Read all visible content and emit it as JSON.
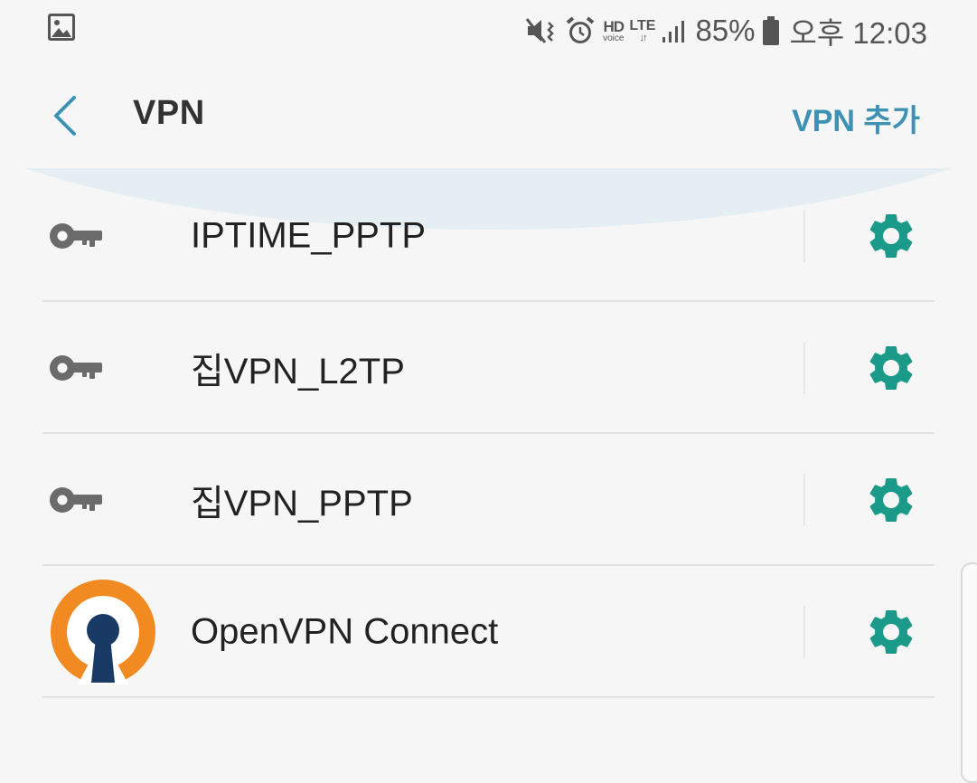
{
  "status_bar": {
    "battery": "85%",
    "time": "오후 12:03",
    "hd_label": "HD",
    "hd_sub": "voice",
    "network_label": "LTE"
  },
  "header": {
    "title": "VPN",
    "add_button_label": "VPN 추가"
  },
  "vpn_list": [
    {
      "name": "IPTIME_PPTP",
      "icon": "key-icon"
    },
    {
      "name": "집VPN_L2TP",
      "icon": "key-icon"
    },
    {
      "name": "집VPN_PPTP",
      "icon": "key-icon"
    },
    {
      "name": "OpenVPN Connect",
      "icon": "openvpn-logo"
    }
  ],
  "colors": {
    "accent": "#3d91b3",
    "gear": "#1b9a8a",
    "key": "#6b6b6b",
    "openvpn_orange": "#f08a21",
    "openvpn_navy": "#1a3a66"
  }
}
